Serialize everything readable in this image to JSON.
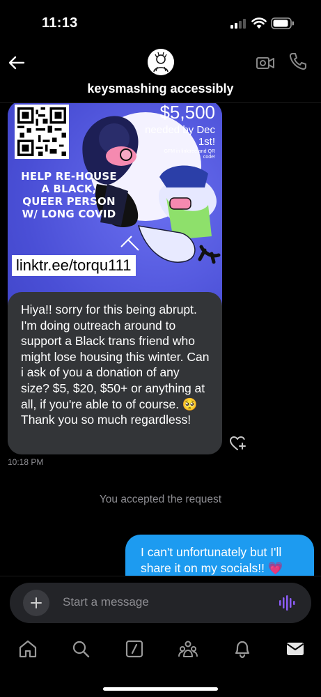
{
  "status_bar": {
    "time": "11:13"
  },
  "header": {
    "contact_name": "keysmashing accessibly"
  },
  "flyer": {
    "amount": "$5,500",
    "needed": "needed by Dec 1st!",
    "gfm_note": "GFM in linktree and QR code!",
    "help_text": "HELP RE-HOUSE A BLACK, QUEER PERSON W/ LONG COVID",
    "link": "linktr.ee/torqu111"
  },
  "messages": {
    "incoming_text": "Hiya!! sorry for this being abrupt. I'm doing outreach around to support a Black trans friend who might lose housing this winter. Can i ask of you a donation of any size? $5, $20, $50+ or anything at all, if you're able to of course. 🥺 Thank you so much regardless!",
    "incoming_time": "10:18 PM",
    "system": "You accepted the request",
    "outgoing_text": "I can't unfortunately but I'll share it on my socials!! 💗"
  },
  "composer": {
    "placeholder": "Start a message"
  },
  "colors": {
    "own_bubble": "#1d9bf0",
    "other_bubble": "#333538",
    "voice_accent": "#8b5cf6"
  },
  "icons": {
    "back": "arrow-left-icon",
    "video": "video-call-icon",
    "phone": "phone-icon",
    "heart_react": "heart-plus-icon",
    "add": "plus-icon",
    "voice": "voice-wave-icon",
    "tabs": [
      "home-icon",
      "search-icon",
      "compose-icon",
      "communities-icon",
      "notifications-icon",
      "messages-icon"
    ]
  }
}
